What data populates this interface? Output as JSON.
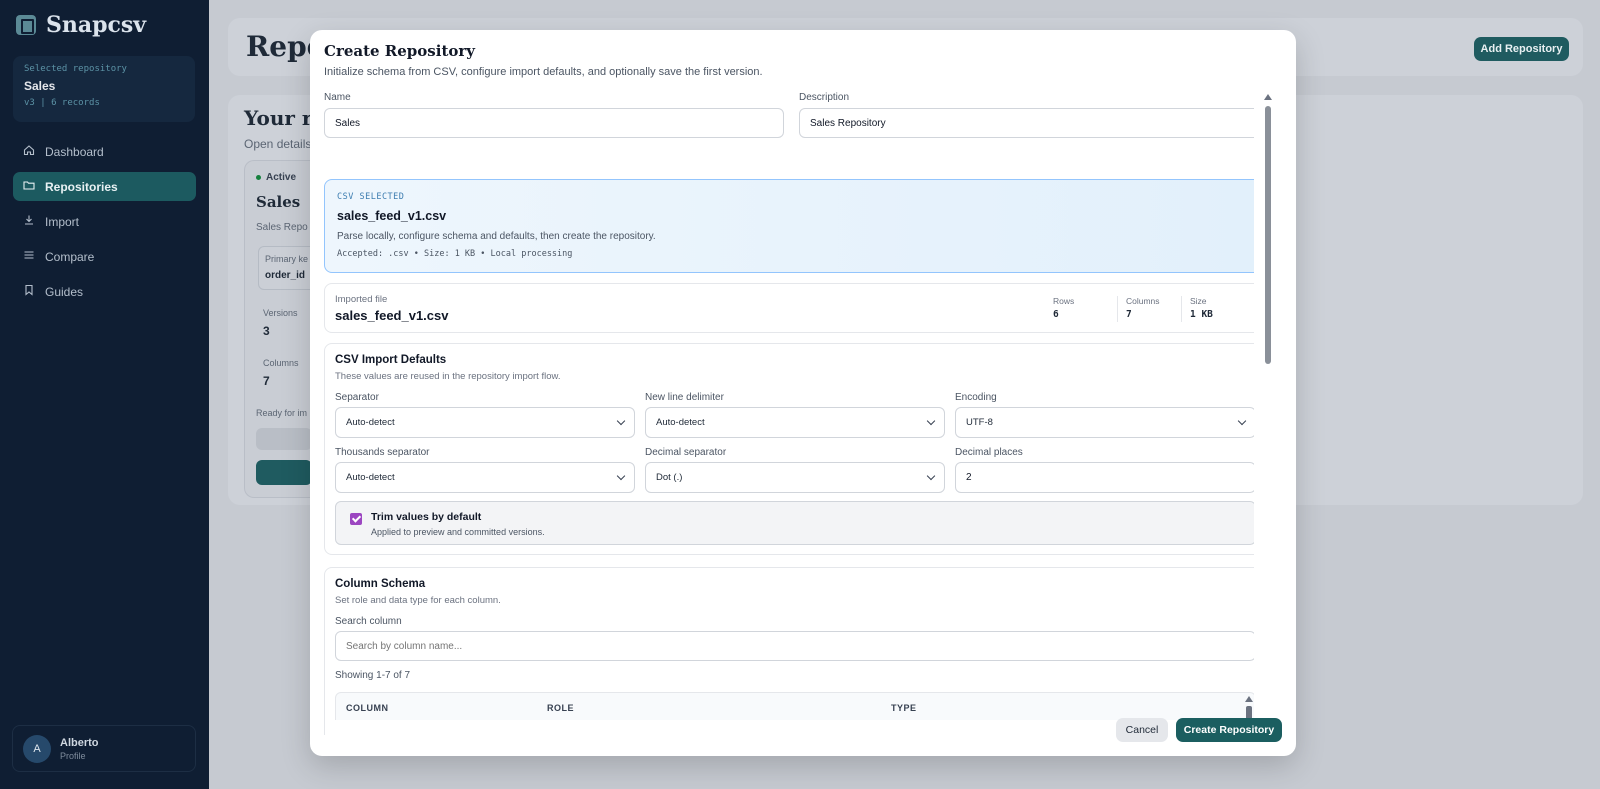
{
  "app": {
    "name": "Snapcsv"
  },
  "sidebar": {
    "selected_caption": "Selected repository",
    "selected_name": "Sales",
    "selected_meta": "v3 | 6 records",
    "items": [
      {
        "label": "Dashboard",
        "icon": "home-icon"
      },
      {
        "label": "Repositories",
        "icon": "folder-icon"
      },
      {
        "label": "Import",
        "icon": "download-icon"
      },
      {
        "label": "Compare",
        "icon": "list-icon"
      },
      {
        "label": "Guides",
        "icon": "bookmark-icon"
      }
    ],
    "profile": {
      "initial": "A",
      "name": "Alberto",
      "sub": "Profile"
    }
  },
  "background": {
    "title": "Repo",
    "add_button": "Add Repository",
    "section_title": "Your re",
    "section_desc": "Open details",
    "card": {
      "status": "Active",
      "name": "Sales",
      "desc": "Sales Repo",
      "pk_label": "Primary ke",
      "pk_value": "order_id",
      "versions_label": "Versions",
      "versions_value": "3",
      "columns_label": "Columns",
      "columns_value": "7",
      "ready": "Ready for im"
    }
  },
  "modal": {
    "title": "Create Repository",
    "subtitle": "Initialize schema from CSV, configure import defaults, and optionally save the first version.",
    "name_label": "Name",
    "name_value": "Sales",
    "desc_label": "Description",
    "desc_value": "Sales Repository",
    "csv": {
      "caption": "CSV SELECTED",
      "filename": "sales_feed_v1.csv",
      "desc": "Parse locally, configure schema and defaults, then create the repository.",
      "accepted": "Accepted: .csv • Size: 1 KB • Local processing"
    },
    "imported": {
      "label": "Imported file",
      "filename": "sales_feed_v1.csv",
      "rows_label": "Rows",
      "rows_value": "6",
      "columns_label": "Columns",
      "columns_value": "7",
      "size_label": "Size",
      "size_value": "1 KB"
    },
    "defaults": {
      "title": "CSV Import Defaults",
      "subtitle": "These values are reused in the repository import flow.",
      "separator_label": "Separator",
      "separator_value": "Auto-detect",
      "newline_label": "New line delimiter",
      "newline_value": "Auto-detect",
      "encoding_label": "Encoding",
      "encoding_value": "UTF-8",
      "thousands_label": "Thousands separator",
      "thousands_value": "Auto-detect",
      "decimal_label": "Decimal separator",
      "decimal_value": "Dot (.)",
      "places_label": "Decimal places",
      "places_value": "2",
      "trim_title": "Trim values by default",
      "trim_desc": "Applied to preview and committed versions.",
      "trim_checked": true,
      "checkbox_color": "#9c46c1"
    },
    "schema": {
      "title": "Column Schema",
      "subtitle": "Set role and data type for each column.",
      "search_label": "Search column",
      "search_placeholder": "Search by column name...",
      "showing": "Showing 1-7 of 7",
      "headers": [
        "COLUMN",
        "ROLE",
        "TYPE"
      ]
    },
    "cancel": "Cancel",
    "create": "Create Repository"
  },
  "colors": {
    "accent": "#1b5e60",
    "sidebar_bg": "#0f1e33",
    "csv_border": "#93c5fd"
  }
}
